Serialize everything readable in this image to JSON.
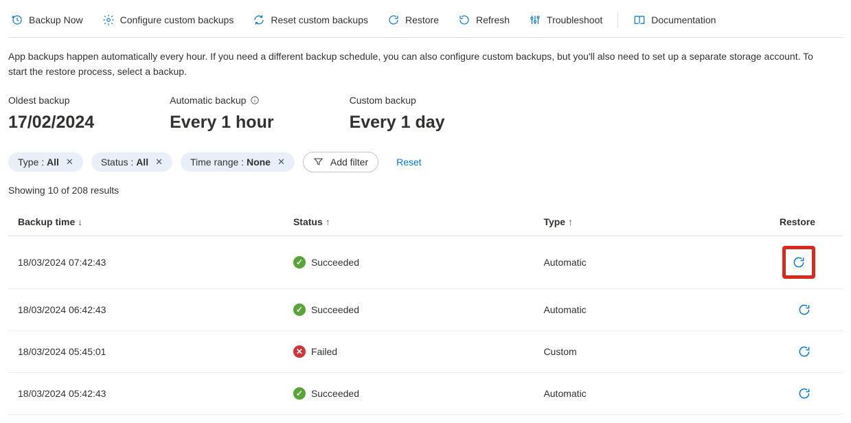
{
  "toolbar": {
    "backup_now": "Backup Now",
    "configure": "Configure custom backups",
    "reset_custom": "Reset custom backups",
    "restore": "Restore",
    "refresh": "Refresh",
    "troubleshoot": "Troubleshoot",
    "documentation": "Documentation"
  },
  "description": "App backups happen automatically every hour. If you need a different backup schedule, you can also configure custom backups, but you'll also need to set up a separate storage account. To start the restore process, select a backup.",
  "stats": {
    "oldest_label": "Oldest backup",
    "oldest_value": "17/02/2024",
    "auto_label": "Automatic backup",
    "auto_value": "Every 1 hour",
    "custom_label": "Custom backup",
    "custom_value": "Every 1 day"
  },
  "filters": {
    "type_label": "Type : ",
    "type_value": "All",
    "status_label": "Status : ",
    "status_value": "All",
    "range_label": "Time range : ",
    "range_value": "None",
    "add_filter": "Add filter",
    "reset": "Reset"
  },
  "results_text": "Showing 10 of 208 results",
  "columns": {
    "time": "Backup time",
    "status": "Status",
    "type": "Type",
    "restore": "Restore"
  },
  "rows": [
    {
      "time": "18/03/2024 07:42:43",
      "status": "Succeeded",
      "status_kind": "success",
      "type": "Automatic",
      "highlight": true
    },
    {
      "time": "18/03/2024 06:42:43",
      "status": "Succeeded",
      "status_kind": "success",
      "type": "Automatic",
      "highlight": false
    },
    {
      "time": "18/03/2024 05:45:01",
      "status": "Failed",
      "status_kind": "failed",
      "type": "Custom",
      "highlight": false
    },
    {
      "time": "18/03/2024 05:42:43",
      "status": "Succeeded",
      "status_kind": "success",
      "type": "Automatic",
      "highlight": false
    }
  ]
}
